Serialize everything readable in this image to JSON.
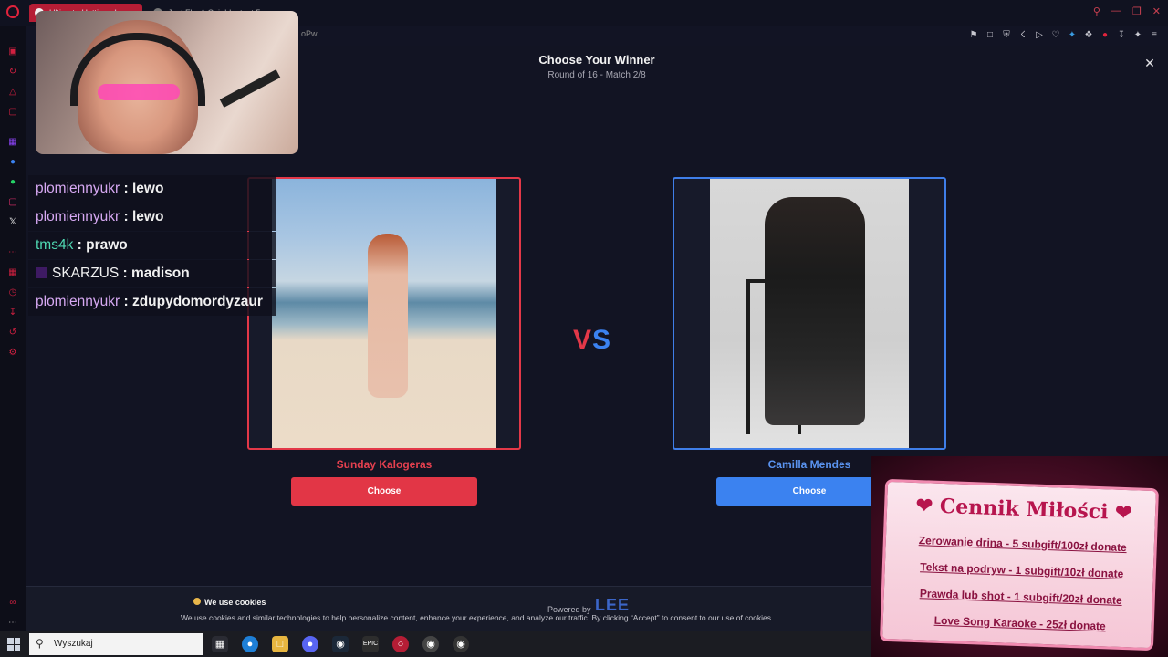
{
  "browser": {
    "tabs": [
      {
        "label": "Ultimate Hotties - Lagwy…",
        "active": true
      },
      {
        "label": "Just Flip A Coin! Instant 5…",
        "active": false
      }
    ],
    "url_fragment": "oPw",
    "accent_color": "#e0233c"
  },
  "dialog": {
    "title": "Choose Your Winner",
    "subtitle": "Round of 16 - Match 2/8",
    "close_label": "✕",
    "vs": {
      "v": "V",
      "s": "S"
    },
    "left": {
      "name": "Sunday Kalogeras",
      "button": "Choose",
      "color": "#e33848"
    },
    "right": {
      "name": "Camilla Mendes",
      "button": "Choose",
      "color": "#3b82f0"
    }
  },
  "cookie_banner": {
    "title": "We use cookies",
    "text": "We use cookies and similar technologies to help personalize content, enhance your experience, and analyze our traffic. By clicking “Accept” to consent to our use of cookies.",
    "powered_by": "Powered by",
    "logo_text": "LEE"
  },
  "chat": [
    {
      "user": "plomiennyukr",
      "sep": " : ",
      "message": "lewo",
      "color": "#d6a8f2",
      "badge": false
    },
    {
      "user": "plomiennyukr",
      "sep": " : ",
      "message": "lewo",
      "color": "#d6a8f2",
      "badge": false
    },
    {
      "user": "tms4k",
      "sep": " : ",
      "message": "prawo",
      "color": "#4fd8b2",
      "badge": false
    },
    {
      "user": "SKARZUS",
      "sep": " : ",
      "message": "madison",
      "color": "#f1f1f1",
      "badge": true
    },
    {
      "user": "plomiennyukr",
      "sep": " : ",
      "message": "zdupydomordyzaur",
      "color": "#d6a8f2",
      "badge": false
    }
  ],
  "price_list": {
    "title": "❤ Cennik Miłości ❤",
    "lines": [
      "Zerowanie drina - 5 subgift/100zł donate",
      "Tekst na podryw - 1 subgift/10zł donate",
      "Prawda lub shot - 1 subgift/20zł donate",
      "Love Song Karaoke - 25zł donate"
    ]
  },
  "taskbar": {
    "search_placeholder": "Wyszukaj"
  }
}
